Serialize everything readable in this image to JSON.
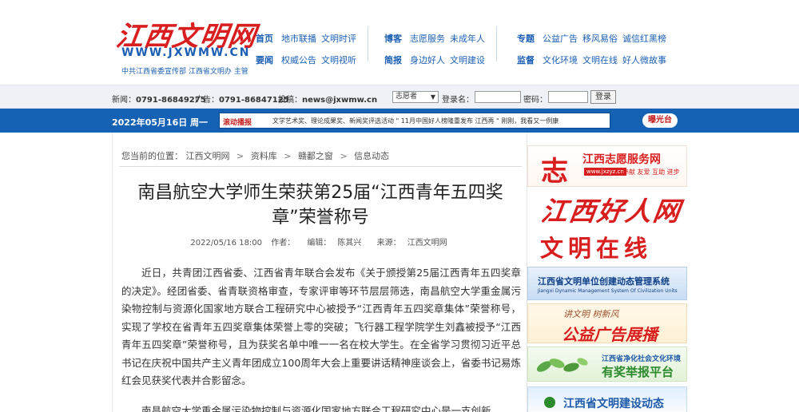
{
  "header": {
    "logo_title": "江西文明网",
    "logo_url": "WWW.JXWMW.CN",
    "logo_sub": "中共江西省委宣传部  江西省文明办 主管",
    "nav_group1": {
      "row1": {
        "lead": "首页",
        "items": [
          "地市联播",
          "文明时评"
        ]
      },
      "row2": {
        "lead": "要闻",
        "items": [
          "权威公告",
          "文明视听"
        ]
      }
    },
    "nav_group2": {
      "row1": {
        "lead": "博客",
        "items": [
          "志愿服务",
          "未成年人"
        ]
      },
      "row2": {
        "lead": "简报",
        "items": [
          "身边好人",
          "文明建设"
        ]
      }
    },
    "nav_group3": {
      "row1": {
        "lead": "专题",
        "items": [
          "公益广告",
          "移风易俗",
          "诚信红黑榜"
        ]
      },
      "row2": {
        "lead": "监督",
        "items": [
          "文化环境",
          "文明在线",
          "好人微故事"
        ]
      }
    }
  },
  "infobar": {
    "news_phone_label": "新闻：",
    "news_phone": "0791-86849275",
    "ad_phone_label": "广告：",
    "ad_phone": "0791-86847125",
    "email_label": "投稿：",
    "email": "news@jxwmw.cn",
    "user_type": "志愿者",
    "login_label": "登录名：",
    "password_label": "密码：",
    "login_button": "登录"
  },
  "bluebar": {
    "date": "2022年05月16日 周一",
    "ticker_label": "滚动播报",
    "ticker_text": "文学艺术奖、理论成果奖、新闻奖评选活动 \" 11月中国好人榜隆重发布 江西再 \" 刚刚，我看又一例康",
    "expose_button": "曝光台"
  },
  "breadcrumb": {
    "prefix": "您当前的位置：",
    "items": [
      "江西文明网",
      "资料库",
      "赣鄱之窗",
      "信息动态"
    ],
    "sep": ">"
  },
  "article": {
    "title": "南昌航空大学师生荣获第25届“江西青年五四奖章”荣誉称号",
    "datetime": "2022/05/16 18:00",
    "author_label": "作者：",
    "editor_label": "编辑：",
    "editor": "陈其兴",
    "source_label": "来源：",
    "source": "江西文明网",
    "para1": "近日，共青团江西省委、江西省青年联合会发布《关于颁授第25届江西青年五四奖章的决定》。经团省委、省青联资格审查，专家评审等环节层层筛选，南昌航空大学重金属污染物控制与资源化国家地方联合工程研究中心被授予“江西青年五四奖章集体”荣誉称号，实现了学校在省青年五四奖章集体荣誉上零的突破；飞行器工程学院学生刘鑫被授予“江西青年五四奖章”荣誉称号，且为获奖名单中唯一一名在校大学生。在全省学习贯彻习近平总书记在庆祝中国共产主义青年团成立100周年大会上重要讲话精神座谈会上，省委书记易炼红会见获奖代表并合影留念。",
    "para2": "南昌航空大学重金属污染物控制与资源化国家地方联合工程研究中心是一支创新"
  },
  "side": {
    "ad1_icon": "志",
    "ad1_title": "江西志愿服务网",
    "ad1_url": "www.jxzyz.cn",
    "ad1_slogan": "奉献 友爱 互助 进步",
    "ad2_title": "江西好人网",
    "ad3_title": "文明在线",
    "ad4_title": "江西省文明单位创建动态管理系统",
    "ad4_sub": "Jiangxi Dynamic Management System Of Civilization Units",
    "ad5_sub": "讲文明  树新风",
    "ad5_title": "公益广告展播",
    "ad6_sub": "江西省净化社会文化环境",
    "ad6_title": "有奖举报平台",
    "ad7_title": "江西省文明建设动态"
  }
}
